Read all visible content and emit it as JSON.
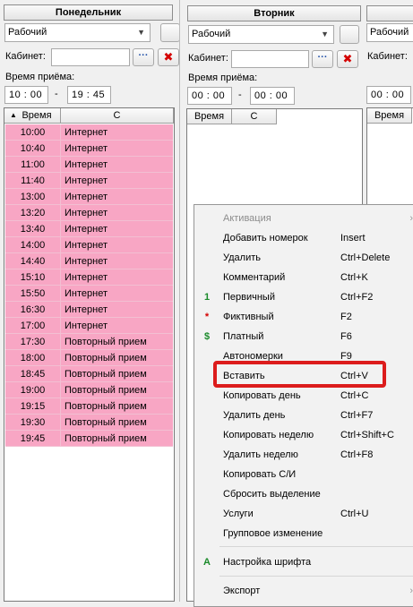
{
  "monday": {
    "title": "Понедельник",
    "mode": "Рабочий",
    "cabinet_label": "Кабинет:",
    "cabinet_value": "",
    "dots": "···",
    "clear": "✖",
    "time_label": "Время приёма:",
    "from": "10 : 00",
    "dash": "-",
    "to": "19 : 45",
    "col_time": "Время",
    "col_c": "С",
    "sort_arrow": "▲",
    "rows": [
      {
        "time": "10:00",
        "text": "Интернет"
      },
      {
        "time": "10:40",
        "text": "Интернет"
      },
      {
        "time": "11:00",
        "text": "Интернет"
      },
      {
        "time": "11:40",
        "text": "Интернет"
      },
      {
        "time": "13:00",
        "text": "Интернет"
      },
      {
        "time": "13:20",
        "text": "Интернет"
      },
      {
        "time": "13:40",
        "text": "Интернет"
      },
      {
        "time": "14:00",
        "text": "Интернет"
      },
      {
        "time": "14:40",
        "text": "Интернет"
      },
      {
        "time": "15:10",
        "text": "Интернет"
      },
      {
        "time": "15:50",
        "text": "Интернет"
      },
      {
        "time": "16:30",
        "text": "Интернет"
      },
      {
        "time": "17:00",
        "text": "Интернет"
      },
      {
        "time": "17:30",
        "text": "Повторный прием"
      },
      {
        "time": "18:00",
        "text": "Повторный прием"
      },
      {
        "time": "18:45",
        "text": "Повторный прием"
      },
      {
        "time": "19:00",
        "text": "Повторный прием"
      },
      {
        "time": "19:15",
        "text": "Повторный прием"
      },
      {
        "time": "19:30",
        "text": "Повторный прием"
      },
      {
        "time": "19:45",
        "text": "Повторный прием"
      }
    ]
  },
  "tuesday": {
    "title": "Вторник",
    "mode": "Рабочий",
    "cabinet_label": "Кабинет:",
    "cabinet_value": "",
    "dots": "···",
    "clear": "✖",
    "time_label": "Время приёма:",
    "from": "00 : 00",
    "dash": "-",
    "to": "00 : 00",
    "col_time": "Время",
    "col_c": "С"
  },
  "wednesday": {
    "mode": "Рабочий",
    "cabinet_label": "Кабинет:",
    "from": "00 : 00",
    "col_time": "Время"
  },
  "context_menu": {
    "items": [
      {
        "label": "Активация",
        "shortcut": "",
        "disabled": true,
        "submenu": "›",
        "icon": ""
      },
      {
        "label": "Добавить номерок",
        "shortcut": "Insert",
        "icon": ""
      },
      {
        "label": "Удалить",
        "shortcut": "Ctrl+Delete",
        "icon": ""
      },
      {
        "label": "Комментарий",
        "shortcut": "Ctrl+K",
        "icon": ""
      },
      {
        "label": "Первичный",
        "shortcut": "Ctrl+F2",
        "icon": "1"
      },
      {
        "label": "Фиктивный",
        "shortcut": "F2",
        "icon": "*"
      },
      {
        "label": "Платный",
        "shortcut": "F6",
        "icon": "$"
      },
      {
        "label": "Автономерки",
        "shortcut": "F9",
        "icon": ""
      },
      {
        "label": "Вставить",
        "shortcut": "Ctrl+V",
        "icon": ""
      },
      {
        "label": "Копировать день",
        "shortcut": "Ctrl+C",
        "icon": ""
      },
      {
        "label": "Удалить день",
        "shortcut": "Ctrl+F7",
        "icon": ""
      },
      {
        "label": "Копировать неделю",
        "shortcut": "Ctrl+Shift+C",
        "icon": ""
      },
      {
        "label": "Удалить неделю",
        "shortcut": "Ctrl+F8",
        "icon": ""
      },
      {
        "label": "Копировать С/И",
        "shortcut": "",
        "icon": ""
      },
      {
        "label": "Сбросить выделение",
        "shortcut": "",
        "icon": ""
      },
      {
        "label": "Услуги",
        "shortcut": "Ctrl+U",
        "icon": ""
      },
      {
        "label": "Групповое изменение",
        "shortcut": "",
        "icon": ""
      },
      {
        "label": "Настройка шрифта",
        "shortcut": "",
        "icon": "A"
      },
      {
        "label": "Экспорт",
        "shortcut": "",
        "submenu": "›",
        "icon": ""
      }
    ]
  },
  "colors": {
    "row_fill": "#f8a6c4",
    "highlight_border": "#dc1c1c",
    "icon_primary": "#1a8a2a",
    "icon_fictive": "#d40000",
    "icon_paid": "#1a8a2a"
  },
  "icons": {
    "combo_arrow": "⌄",
    "submenu_arrow": "›"
  }
}
